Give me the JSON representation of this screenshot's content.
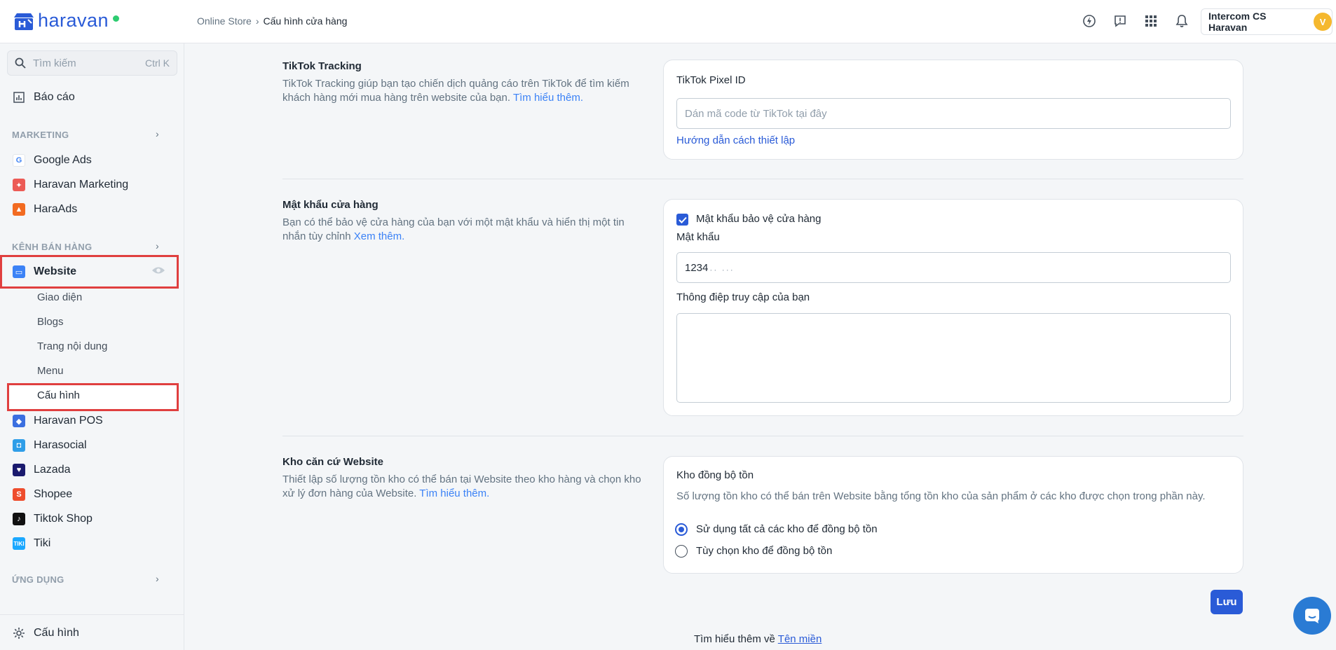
{
  "header": {
    "logo_text": "haravan",
    "breadcrumb": [
      "Online Store",
      "Cấu hình cửa hàng"
    ],
    "account_name": "Intercom CS Haravan",
    "avatar_letter": "V"
  },
  "sidebar": {
    "search_placeholder": "Tìm kiếm",
    "search_shortcut": "Ctrl K",
    "report": "Báo cáo",
    "sections": {
      "marketing": "MARKETING",
      "sales_channels": "KÊNH BÁN HÀNG",
      "apps": "ỨNG DỤNG"
    },
    "marketing_items": [
      "Google Ads",
      "Haravan Marketing",
      "HaraAds"
    ],
    "website": "Website",
    "website_sub": [
      "Giao diện",
      "Blogs",
      "Trang nội dung",
      "Menu",
      "Cấu hình"
    ],
    "channel_items": [
      "Haravan POS",
      "Harasocial",
      "Lazada",
      "Shopee",
      "Tiktok Shop",
      "Tiki"
    ],
    "settings": "Cấu hình"
  },
  "tiktok": {
    "title": "TikTok Tracking",
    "desc": "TikTok Tracking giúp bạn tạo chiến dịch quảng cáo trên TikTok để tìm kiếm khách hàng mới mua hàng trên website của bạn.",
    "desc_link": "Tìm hiểu thêm.",
    "pixel_label": "TikTok Pixel ID",
    "pixel_placeholder": "Dán mã code từ TikTok tại đây",
    "setup_link": "Hướng dẫn cách thiết lập"
  },
  "password": {
    "title": "Mật khẩu cửa hàng",
    "desc": "Bạn có thể bảo vệ cửa hàng của bạn với một mật khẩu và hiển thị một tin nhắn tùy chỉnh",
    "desc_link": "Xem thêm.",
    "checkbox_label": "Mật khẩu bảo vệ cửa hàng",
    "checked": true,
    "pw_label": "Mật khẩu",
    "pw_value": "1234",
    "message_label": "Thông điệp truy cập của bạn",
    "message_value": ""
  },
  "warehouse": {
    "title": "Kho căn cứ Website",
    "desc": "Thiết lập số lượng tồn kho có thể bán tại Website theo kho hàng và chọn kho xử lý đơn hàng của Website.",
    "desc_link": "Tìm hiểu thêm.",
    "sync_title": "Kho đồng bộ tồn",
    "sync_desc": "Số lượng tồn kho có thể bán trên Website bằng tổng tồn kho của sản phẩm ở các kho được chọn trong phần này.",
    "option_all": "Sử dụng tất cả các kho để đồng bộ tồn",
    "option_custom": "Tùy chọn kho để đồng bộ tồn",
    "selected": "option_all"
  },
  "save_label": "Lưu",
  "footer": {
    "text": "Tìm hiểu thêm về",
    "link": "Tên miền"
  },
  "colors": {
    "accent": "#2a5bd7",
    "highlight_box": "#e03f3f"
  }
}
